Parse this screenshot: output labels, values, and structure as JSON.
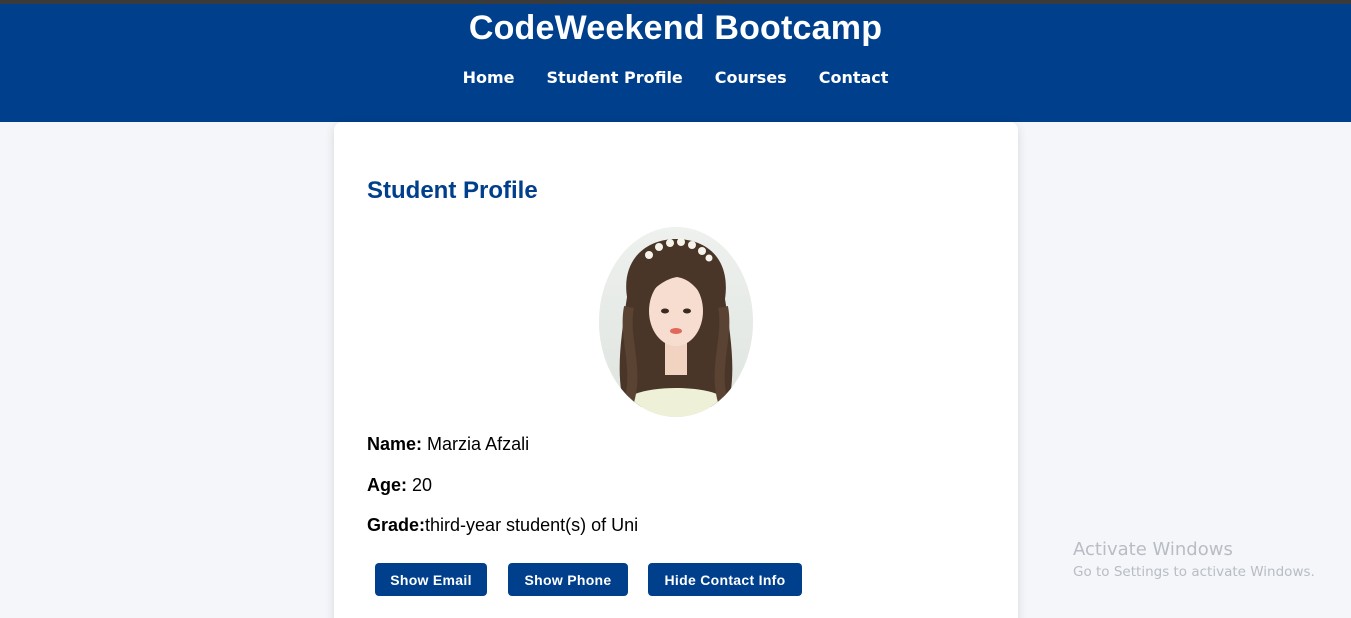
{
  "header": {
    "title": "CodeWeekend Bootcamp",
    "nav": [
      "Home",
      "Student Profile",
      "Courses",
      "Contact"
    ],
    "background_color": "#003f8c"
  },
  "profile": {
    "heading": "Student Profile",
    "avatar_icon": "student-photo",
    "name_label": "Name:",
    "name_value": "Marzia Afzali",
    "age_label": "Age:",
    "age_value": "20",
    "grade_label": "Grade:",
    "grade_value": "third-year student(s) of Uni",
    "buttons": {
      "email": "Show Email",
      "phone": "Show Phone",
      "hide": "Hide Contact Info"
    },
    "accent_color": "#003f8c"
  },
  "watermark": {
    "title": "Activate Windows",
    "subtitle": "Go to Settings to activate Windows."
  }
}
